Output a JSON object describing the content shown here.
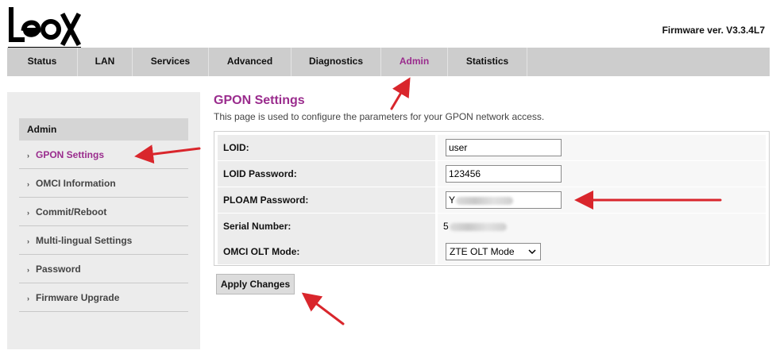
{
  "header": {
    "logo_text": "leox",
    "firmware_version": "Firmware ver. V3.3.4L7"
  },
  "nav": {
    "tabs": [
      {
        "label": "Status"
      },
      {
        "label": "LAN"
      },
      {
        "label": "Services"
      },
      {
        "label": "Advanced"
      },
      {
        "label": "Diagnostics"
      },
      {
        "label": "Admin",
        "active": true
      },
      {
        "label": "Statistics"
      }
    ]
  },
  "sidebar": {
    "header": "Admin",
    "items": [
      {
        "label": "GPON Settings",
        "active": true
      },
      {
        "label": "OMCI Information"
      },
      {
        "label": "Commit/Reboot"
      },
      {
        "label": "Multi-lingual Settings"
      },
      {
        "label": "Password"
      },
      {
        "label": "Firmware Upgrade"
      }
    ]
  },
  "main": {
    "title": "GPON Settings",
    "description": "This page is used to configure the parameters for your GPON network access.",
    "form": {
      "loid_label": "LOID:",
      "loid_value": "user",
      "loid_password_label": "LOID Password:",
      "loid_password_value": "123456",
      "ploam_password_label": "PLOAM Password:",
      "ploam_password_value": "Y",
      "serial_label": "Serial Number:",
      "serial_value": "5",
      "omci_mode_label": "OMCI OLT Mode:",
      "omci_mode_value": "ZTE OLT Mode"
    },
    "apply_label": "Apply Changes"
  },
  "colors": {
    "accent": "#9a2c8d",
    "nav_bg": "#cdcdcd",
    "annotation_arrow": "#d9262c"
  },
  "icons": {
    "bullet": "›",
    "dropdown": "chevron-down-icon"
  }
}
